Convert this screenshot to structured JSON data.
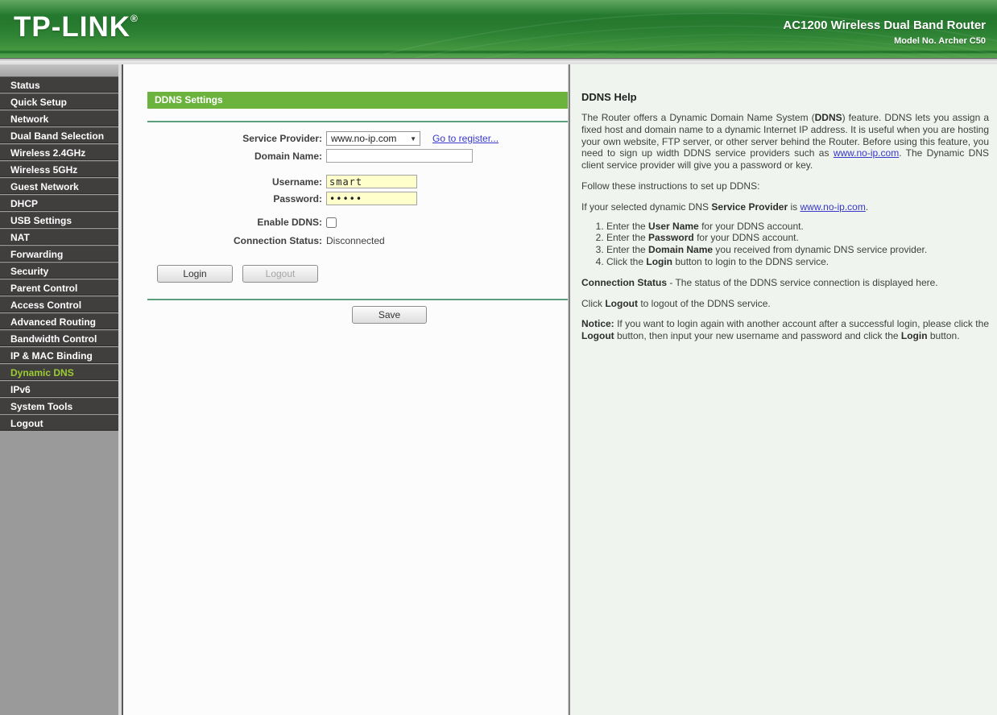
{
  "header": {
    "logo": "TP-LINK",
    "logo_reg": "®",
    "product_title": "AC1200 Wireless Dual Band Router",
    "model": "Model No. Archer C50"
  },
  "sidebar": {
    "items": [
      {
        "label": "Status",
        "active": false
      },
      {
        "label": "Quick Setup",
        "active": false
      },
      {
        "label": "Network",
        "active": false
      },
      {
        "label": "Dual Band Selection",
        "active": false
      },
      {
        "label": "Wireless 2.4GHz",
        "active": false
      },
      {
        "label": "Wireless 5GHz",
        "active": false
      },
      {
        "label": "Guest Network",
        "active": false
      },
      {
        "label": "DHCP",
        "active": false
      },
      {
        "label": "USB Settings",
        "active": false
      },
      {
        "label": "NAT",
        "active": false
      },
      {
        "label": "Forwarding",
        "active": false
      },
      {
        "label": "Security",
        "active": false
      },
      {
        "label": "Parent Control",
        "active": false
      },
      {
        "label": "Access Control",
        "active": false
      },
      {
        "label": "Advanced Routing",
        "active": false
      },
      {
        "label": "Bandwidth Control",
        "active": false
      },
      {
        "label": "IP & MAC Binding",
        "active": false
      },
      {
        "label": "Dynamic DNS",
        "active": true
      },
      {
        "label": "IPv6",
        "active": false
      },
      {
        "label": "System Tools",
        "active": false
      },
      {
        "label": "Logout",
        "active": false
      }
    ]
  },
  "main": {
    "section_title": "DDNS Settings",
    "fields": {
      "service_provider": {
        "label": "Service Provider:",
        "value": "www.no-ip.com"
      },
      "domain_name": {
        "label": "Domain Name:",
        "value": "",
        "placeholder": ""
      },
      "username": {
        "label": "Username:",
        "value": "smart"
      },
      "password": {
        "label": "Password:",
        "value": "•••••"
      },
      "enable_ddns": {
        "label": "Enable DDNS:",
        "checked": false
      },
      "connection_status": {
        "label": "Connection Status:",
        "value": "Disconnected"
      }
    },
    "links": {
      "register": "Go to register..."
    },
    "buttons": {
      "login": "Login",
      "logout": "Logout",
      "save": "Save"
    }
  },
  "help": {
    "title": "DDNS Help",
    "blocks": [
      {
        "type": "p",
        "segments": [
          {
            "t": "The Router offers a Dynamic Domain Name System ("
          },
          {
            "t": "DDNS",
            "b": true
          },
          {
            "t": ") feature. DDNS lets you assign a fixed host and domain name to a dynamic Internet IP address. It is useful when you are hosting your own website, FTP server, or other server behind the Router. Before using this feature, you need to sign up width DDNS service providers such as "
          },
          {
            "t": "www.no-ip.com",
            "link": true
          },
          {
            "t": ". The Dynamic DNS client service provider will give you a password or key."
          }
        ]
      },
      {
        "type": "p",
        "segments": [
          {
            "t": "Follow these instructions to set up DDNS:"
          }
        ]
      },
      {
        "type": "p",
        "segments": [
          {
            "t": "If your selected dynamic DNS "
          },
          {
            "t": "Service Provider",
            "b": true
          },
          {
            "t": " is "
          },
          {
            "t": "www.no-ip.com",
            "link": true
          },
          {
            "t": "."
          }
        ]
      },
      {
        "type": "ol",
        "items": [
          [
            {
              "t": "Enter the "
            },
            {
              "t": "User Name",
              "b": true
            },
            {
              "t": " for your DDNS account."
            }
          ],
          [
            {
              "t": "Enter the "
            },
            {
              "t": "Password",
              "b": true
            },
            {
              "t": " for your DDNS account."
            }
          ],
          [
            {
              "t": "Enter the "
            },
            {
              "t": "Domain Name",
              "b": true
            },
            {
              "t": " you received from dynamic DNS service provider."
            }
          ],
          [
            {
              "t": "Click the "
            },
            {
              "t": "Login",
              "b": true
            },
            {
              "t": " button to login to the DDNS service."
            }
          ]
        ]
      },
      {
        "type": "p",
        "segments": [
          {
            "t": "Connection Status",
            "b": true
          },
          {
            "t": " - The status of the DDNS service connection is displayed here."
          }
        ]
      },
      {
        "type": "p",
        "segments": [
          {
            "t": "Click "
          },
          {
            "t": "Logout",
            "b": true
          },
          {
            "t": " to logout of the DDNS service."
          }
        ]
      },
      {
        "type": "p",
        "segments": [
          {
            "t": "Notice:",
            "b": true
          },
          {
            "t": "  If you want to login again with another account after a successful login, please click the "
          },
          {
            "t": "Logout",
            "b": true
          },
          {
            "t": " button, then input your new username and password and click the "
          },
          {
            "t": "Login",
            "b": true
          },
          {
            "t": " button."
          }
        ]
      }
    ]
  },
  "colors": {
    "accent_green": "#6cb33d",
    "header_green": "#2e8334",
    "active_item_text": "#9acd32",
    "link_blue": "#3737c8",
    "input_highlight": "#ffffcc",
    "separator_green": "#5b9e7d"
  }
}
